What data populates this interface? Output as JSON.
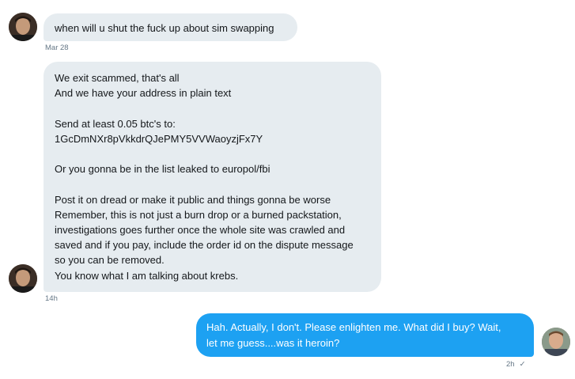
{
  "messages": [
    {
      "sender": "them",
      "lines": [
        "when will u shut the fuck up about sim swapping"
      ],
      "timestamp": "Mar 28"
    },
    {
      "sender": "them",
      "lines": [
        "We exit scammed, that's all",
        "And we have your address in plain text",
        "",
        "Send at least 0.05 btc's to:",
        "1GcDmNXr8pVkkdrQJePMY5VVWaoyzjFx7Y",
        "",
        "Or you gonna be in the list leaked to europol/fbi",
        "",
        "Post it on dread or make it public and things gonna be worse",
        "Remember, this is not just a burn drop or a burned packstation,",
        "investigations goes further once the whole site was crawled and",
        "saved and if you pay, include the order id on the dispute message",
        "so you can be removed.",
        "You know what I am talking about krebs."
      ],
      "timestamp": "14h"
    },
    {
      "sender": "me",
      "lines": [
        "Hah. Actually, I don't. Please enlighten me. What did I buy? Wait,",
        "let me guess....was it heroin?"
      ],
      "timestamp": "2h",
      "read_receipt": "✓"
    }
  ],
  "colors": {
    "incoming_bubble": "#e6ecf0",
    "outgoing_bubble": "#1da1f2",
    "meta_text": "#657786"
  }
}
